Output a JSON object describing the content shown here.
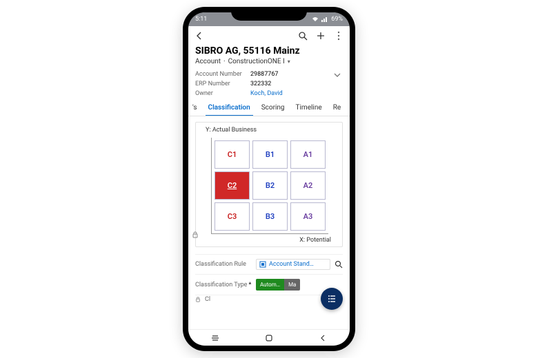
{
  "status": {
    "time": "5:11",
    "battery": "69%"
  },
  "header": {
    "title": "SIBRO AG, 55116 Mainz",
    "subtitle_entity": "Account",
    "subtitle_form": "ConstructionONE I"
  },
  "details": {
    "account_number_label": "Account Number",
    "account_number_value": "29887767",
    "erp_number_label": "ERP Number",
    "erp_number_value": "322332",
    "owner_label": "Owner",
    "owner_value": "Koch, David"
  },
  "tabs": {
    "t0": "'s",
    "t1": "Classification",
    "t2": "Scoring",
    "t3": "Timeline",
    "t4": "Re"
  },
  "chart_data": {
    "type": "heatmap",
    "ylabel": "Y: Actual Business",
    "xlabel": "X: Potential",
    "rows": 3,
    "cols": 3,
    "cells": [
      {
        "label": "C1",
        "group": "c",
        "selected": false
      },
      {
        "label": "B1",
        "group": "b",
        "selected": false
      },
      {
        "label": "A1",
        "group": "a",
        "selected": false
      },
      {
        "label": "C2",
        "group": "c",
        "selected": true
      },
      {
        "label": "B2",
        "group": "b",
        "selected": false
      },
      {
        "label": "A2",
        "group": "a",
        "selected": false
      },
      {
        "label": "C3",
        "group": "c",
        "selected": false
      },
      {
        "label": "B3",
        "group": "b",
        "selected": false
      },
      {
        "label": "A3",
        "group": "a",
        "selected": false
      }
    ]
  },
  "form": {
    "rule_label": "Classification Rule",
    "rule_value": "Account Stand…",
    "type_label": "Classification Type",
    "type_auto": "Autom…",
    "type_manual": "Ma",
    "cut_label": "Cl"
  }
}
